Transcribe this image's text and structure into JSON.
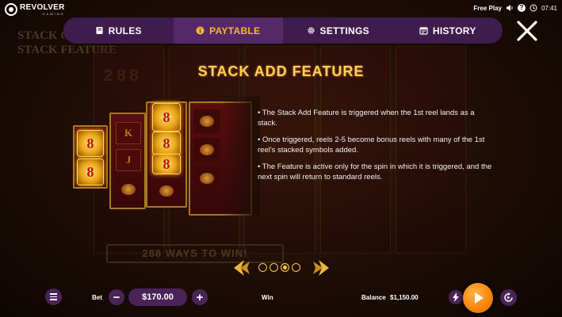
{
  "brand": {
    "name": "REVOLVER",
    "sub": "GAMING"
  },
  "status": {
    "mode": "Free Play",
    "time": "07:41",
    "help": "?"
  },
  "tabs": [
    {
      "label": "RULES",
      "icon": "book-icon"
    },
    {
      "label": "PAYTABLE",
      "icon": "info-icon"
    },
    {
      "label": "SETTINGS",
      "icon": "gear-icon"
    },
    {
      "label": "HISTORY",
      "icon": "calendar-icon"
    }
  ],
  "active_tab": "PAYTABLE",
  "page": {
    "title": "STACK ADD FEATURE",
    "bullets": [
      "• The Stack Add Feature is triggered when the 1st reel lands as a stack.",
      "• Once triggered, reels 2-5 become bonus reels with many of the 1st reel's stacked symbols added.",
      "• The Feature is active only for the spin in which it is triggered, and the next spin will return to standard reels."
    ],
    "pager": {
      "total": 4,
      "current": 3
    }
  },
  "illustration": {
    "stack_symbol": "8",
    "card_letters": [
      "K",
      "J"
    ]
  },
  "background": {
    "left_text": [
      "STACK ON",
      "STACK FEATURE"
    ],
    "ways_text": "288 WAYS TO WIN!",
    "counter": "288"
  },
  "bottom": {
    "bet_label": "Bet",
    "bet_value": "$170.00",
    "minus": "−",
    "plus": "+",
    "win_label": "Win",
    "balance_label": "Balance",
    "balance_value": "$1,150.00"
  },
  "colors": {
    "accent": "#f7b733",
    "tabbar": "#3e1c4d",
    "spin": "#f57c00"
  }
}
